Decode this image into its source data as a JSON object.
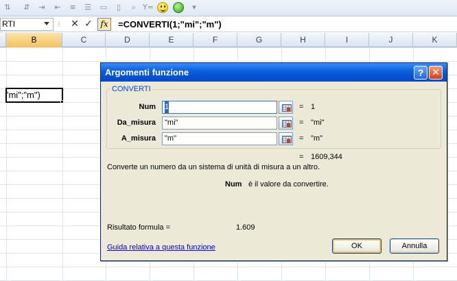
{
  "formula_bar": {
    "name_box": "RTI",
    "formula": "=CONVERTI(1;\"mi\";\"m\")",
    "fx": "fx"
  },
  "toolbar": {
    "icons": [
      "sort-asc-icon",
      "sort-desc-icon",
      "indent-icon",
      "outdent-icon",
      "group-icon",
      "ungroup-icon",
      "open-icon",
      "new-icon",
      "print-preview-icon",
      "formula-icon",
      "smiley-icon",
      "green-circle-icon",
      "dropdown-arrow-icon"
    ]
  },
  "columns": [
    "B",
    "C",
    "D",
    "E",
    "F",
    "G",
    "H",
    "I",
    "J",
    "K"
  ],
  "active_cell": {
    "text": "'mi\";\"m\")"
  },
  "dialog": {
    "title": "Argomenti funzione",
    "help_label": "?",
    "close_label": "✕",
    "function_name": "CONVERTI",
    "arguments": [
      {
        "label": "Num",
        "value": "1",
        "result": "1"
      },
      {
        "label": "Da_misura",
        "value": "\"mi\"",
        "result": "\"mi\""
      },
      {
        "label": "A_misura",
        "value": "\"m\"",
        "result": "\"m\""
      }
    ],
    "equals": "=",
    "function_result": "1609,344",
    "description": "Converte un numero da un sistema di unità di misura a un altro.",
    "argument_help_name": "Num",
    "argument_help_text": "è il valore da convertire.",
    "formula_result_label": "Risultato formula =",
    "formula_result_value": "1.609",
    "help_link": "Guida relativa a questa funzione",
    "ok_label": "OK",
    "cancel_label": "Annulla"
  },
  "colors": {
    "title_bar": "#0a5fd8",
    "dialog_bg": "#ece9d8",
    "link": "#0000cc",
    "group_legend": "#0046d5"
  }
}
